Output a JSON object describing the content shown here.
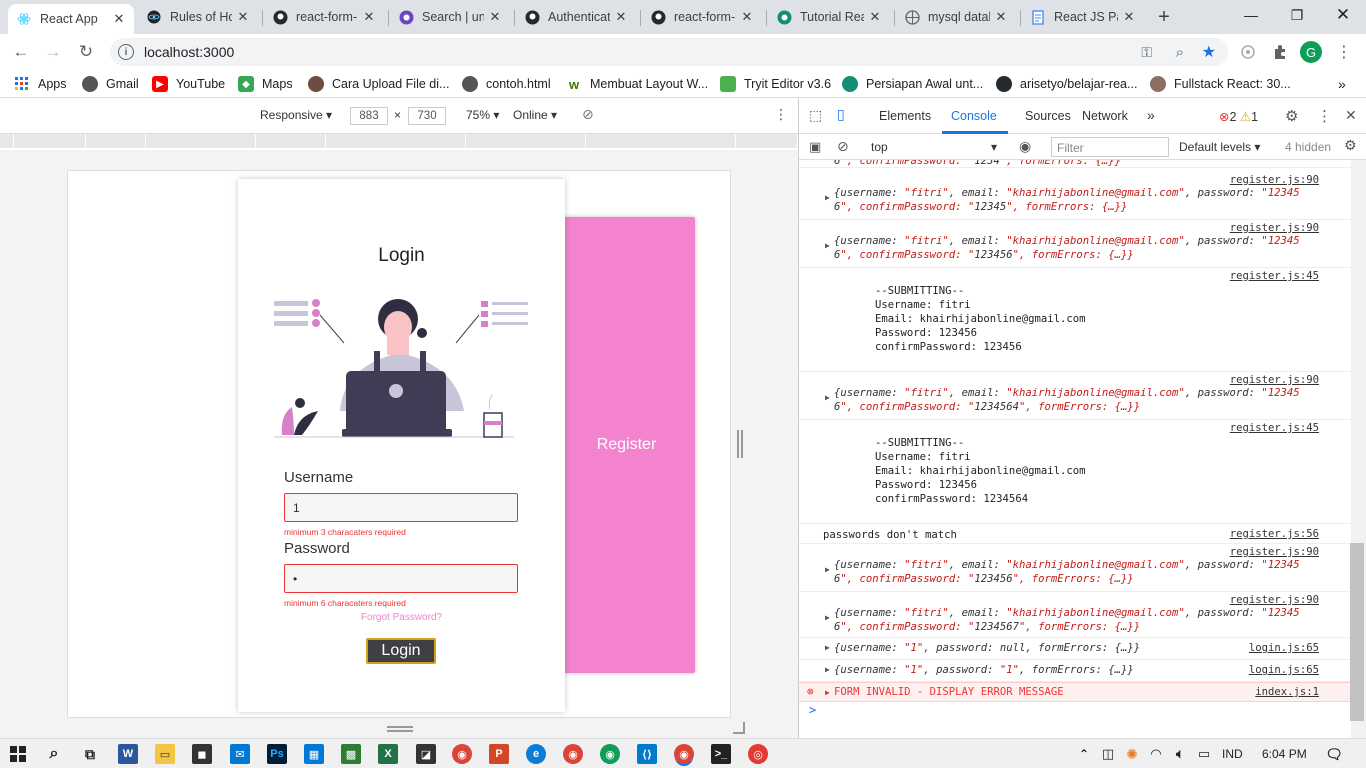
{
  "tabs": [
    {
      "title": "React App",
      "active": true
    },
    {
      "title": "Rules of Ho"
    },
    {
      "title": "react-form-"
    },
    {
      "title": "Search | un"
    },
    {
      "title": "Authenticat"
    },
    {
      "title": "react-form-"
    },
    {
      "title": "Tutorial Rea"
    },
    {
      "title": "mysql datal"
    },
    {
      "title": "React JS Pa"
    }
  ],
  "new_tab": "+",
  "address": {
    "url": "localhost:3000"
  },
  "profile_initial": "G",
  "bookmarks": [
    {
      "label": "Apps"
    },
    {
      "label": "Gmail"
    },
    {
      "label": "YouTube"
    },
    {
      "label": "Maps"
    },
    {
      "label": "Cara Upload File di..."
    },
    {
      "label": "contoh.html"
    },
    {
      "label": "Membuat Layout W..."
    },
    {
      "label": "Tryit Editor v3.6"
    },
    {
      "label": "Persiapan Awal unt..."
    },
    {
      "label": "arisetyo/belajar-rea..."
    },
    {
      "label": "Fullstack React: 30..."
    }
  ],
  "device_toolbar": {
    "mode": "Responsive",
    "width": "883",
    "height": "730",
    "times": "×",
    "zoom": "75%",
    "network": "Online"
  },
  "app": {
    "login_title": "Login",
    "username_label": "Username",
    "username_value": "1",
    "username_error": "minimum 3 characaters required",
    "password_label": "Password",
    "password_value": "•",
    "password_error": "minimum 6 characaters required",
    "forgot_link": "Forgot Password?",
    "login_button": "Login",
    "register_panel": "Register"
  },
  "devtools": {
    "tabs": [
      "Elements",
      "Console",
      "Sources",
      "Network"
    ],
    "active_tab": "Console",
    "more": "»",
    "error_count": "2",
    "warning_count": "1",
    "context": "top",
    "filter_placeholder": "Filter",
    "levels": "Default levels",
    "hidden": "4 hidden"
  },
  "console": {
    "partial_top": "6\", confirmPassword: \"1234\", formErrors: {…}}",
    "entries": [
      {
        "src": "register.js:90",
        "l1": "{username: \"fitri\", email: \"khairhijabonline@gmail.com\", password: \"12345",
        "l2": "6\", confirmPassword: \"12345\", formErrors: {…}}"
      },
      {
        "src": "register.js:90",
        "l1": "{username: \"fitri\", email: \"khairhijabonline@gmail.com\", password: \"12345",
        "l2": "6\", confirmPassword: \"123456\", formErrors: {…}}"
      },
      {
        "src": "register.js:45",
        "text": "--SUBMITTING--\nUsername: fitri\nEmail: khairhijabonline@gmail.com\nPassword: 123456\nconfirmPassword: 123456"
      },
      {
        "src": "register.js:90",
        "l1": "{username: \"fitri\", email: \"khairhijabonline@gmail.com\", password: \"12345",
        "l2": "6\", confirmPassword: \"1234564\", formErrors: {…}}"
      },
      {
        "src": "register.js:45",
        "text": "--SUBMITTING--\nUsername: fitri\nEmail: khairhijabonline@gmail.com\nPassword: 123456\nconfirmPassword: 1234564"
      },
      {
        "src": "register.js:56",
        "text": "passwords don't match"
      },
      {
        "src": "register.js:90",
        "l1": "{username: \"fitri\", email: \"khairhijabonline@gmail.com\", password: \"12345",
        "l2": "6\", confirmPassword: \"123456\", formErrors: {…}}"
      },
      {
        "src": "register.js:90",
        "l1": "{username: \"fitri\", email: \"khairhijabonline@gmail.com\", password: \"12345",
        "l2": "6\", confirmPassword: \"1234567\", formErrors: {…}}"
      },
      {
        "src": "login.js:65",
        "l1": "{username: \"1\", password: null, formErrors: {…}}"
      },
      {
        "src": "login.js:65",
        "l1": "{username: \"1\", password: \"1\", formErrors: {…}}"
      },
      {
        "src": "index.js:1",
        "error": "FORM INVALID - DISPLAY ERROR MESSAGE"
      }
    ],
    "prompt": ">"
  },
  "taskbar": {
    "lang": "IND",
    "time": "6:04 PM"
  },
  "colors": {
    "accent_pink": "#f383cf",
    "error_red": "#e33",
    "button_dark": "#3f3f46",
    "button_border": "#d4a017"
  }
}
